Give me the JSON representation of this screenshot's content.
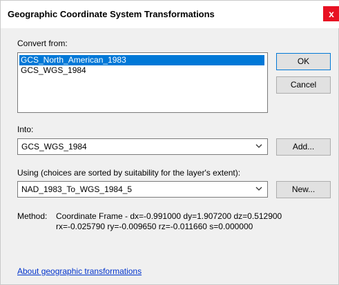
{
  "window": {
    "title": "Geographic Coordinate System Transformations",
    "close_label": "x"
  },
  "convert_from": {
    "label": "Convert from:",
    "items": [
      "GCS_North_American_1983",
      "GCS_WGS_1984"
    ],
    "selected_index": 0
  },
  "into": {
    "label": "Into:",
    "value": "GCS_WGS_1984"
  },
  "using": {
    "label": "Using (choices are sorted by suitability for the layer's extent):",
    "value": "NAD_1983_To_WGS_1984_5"
  },
  "buttons": {
    "ok": "OK",
    "cancel": "Cancel",
    "add": "Add...",
    "new": "New..."
  },
  "method": {
    "label": "Method:",
    "line1": "Coordinate Frame - dx=-0.991000 dy=1.907200 dz=0.512900",
    "line2": "rx=-0.025790 ry=-0.009650 rz=-0.011660 s=0.000000"
  },
  "link": {
    "text": "About geographic transformations"
  },
  "colors": {
    "selection": "#0078d7",
    "close_button": "#e81123",
    "link": "#0033cc"
  }
}
